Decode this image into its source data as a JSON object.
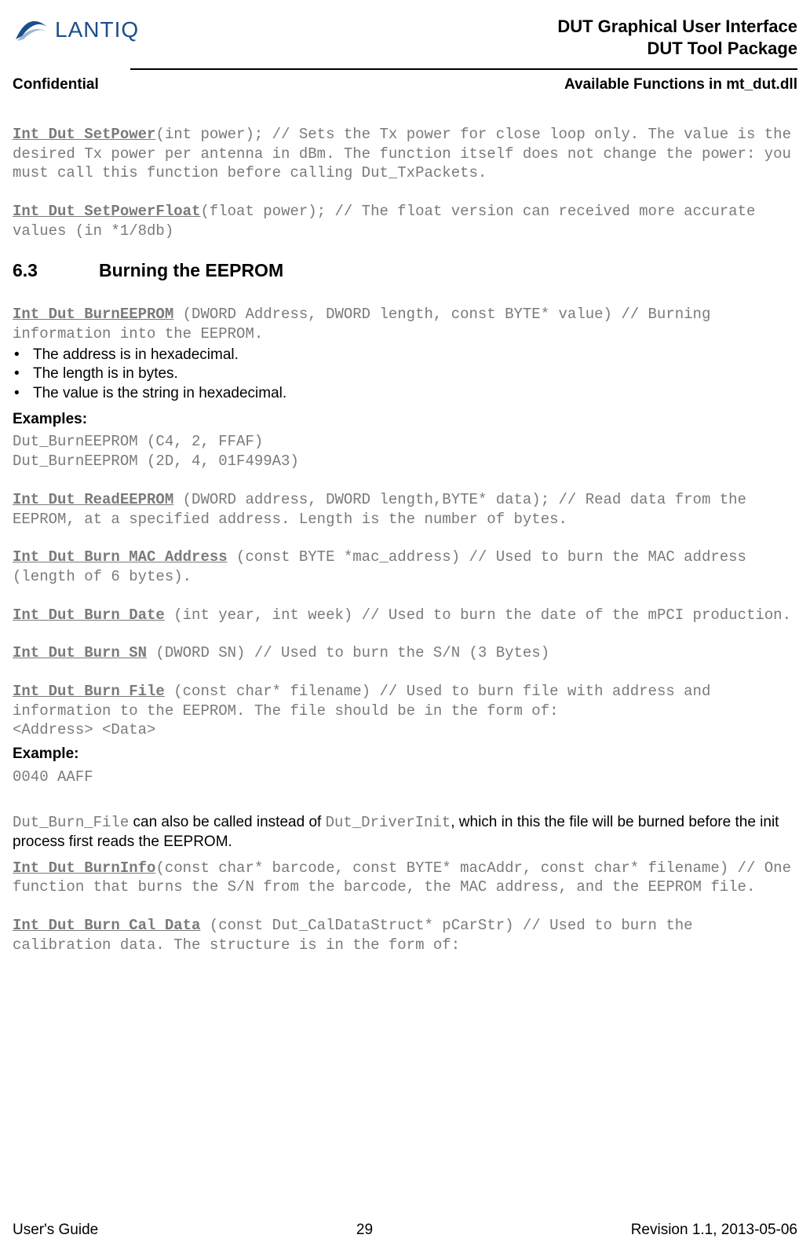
{
  "header": {
    "brand": "LANTIQ",
    "title1": "DUT Graphical User Interface",
    "title2": "DUT Tool Package"
  },
  "subheader": {
    "left": "Confidential",
    "right": "Available Functions in mt_dut.dll"
  },
  "fn1": {
    "name": "Int Dut_SetPower",
    "rest": "(int power); // Sets the Tx power for close loop only. The value is the desired Tx power per antenna in dBm. The function itself does not change the power: you must call this function before calling Dut_TxPackets."
  },
  "fn2": {
    "name": "Int Dut_SetPowerFloat",
    "rest": "(float power); // The float version can received more accurate values (in *1/8db)"
  },
  "section": {
    "num": "6.3",
    "title": "Burning the EEPROM"
  },
  "fn3": {
    "name": "Int Dut_BurnEEPROM",
    "rest": " (DWORD Address, DWORD length, const BYTE* value) // Burning information into the EEPROM."
  },
  "bullets": [
    "The address is in hexadecimal.",
    "The length is in bytes.",
    "The value is the string in hexadecimal."
  ],
  "examples_label": "Examples:",
  "examples": "Dut_BurnEEPROM (C4, 2, FFAF)\nDut_BurnEEPROM (2D, 4, 01F499A3)",
  "fn4": {
    "name": "Int Dut_ReadEEPROM",
    "rest": " (DWORD address, DWORD length,BYTE* data); // Read data from the EEPROM, at a specified address. Length is the number of bytes."
  },
  "fn5": {
    "name": "Int Dut_Burn_MAC_Address",
    "rest": " (const BYTE *mac_address) // Used to burn the MAC address (length of 6 bytes)."
  },
  "fn6": {
    "name": "Int Dut_Burn_Date",
    "rest": " (int year, int week) // Used to burn the date of the mPCI production."
  },
  "fn7": {
    "name": "Int Dut_Burn_SN",
    "rest": " (DWORD SN) // Used to burn the S/N (3 Bytes)"
  },
  "fn8": {
    "name": "Int Dut_Burn_File",
    "rest": " (const char* filename) // Used to burn file with address and information to the EEPROM. The file should be in the form of:\n<Address> <Data>"
  },
  "example_label": "Example:",
  "example_body": "0040 AAFF",
  "note": {
    "p1a": "Dut_Burn_File",
    "p1b": " can also be called instead of ",
    "p1c": "Dut_DriverInit",
    "p1d": ", which in this the file will be burned before the init process first reads the EEPROM."
  },
  "fn9": {
    "name": "Int Dut_BurnInfo",
    "rest": "(const char* barcode, const BYTE* macAddr, const char* filename) // One function that burns the S/N from the barcode, the MAC address, and the EEPROM file."
  },
  "fn10": {
    "name": "Int Dut_Burn_Cal_Data",
    "rest": " (const Dut_CalDataStruct* pCarStr) // Used to burn the calibration data. The structure is in the form of:"
  },
  "footer": {
    "left": "User's Guide",
    "center": "29",
    "right": "Revision 1.1, 2013-05-06"
  }
}
